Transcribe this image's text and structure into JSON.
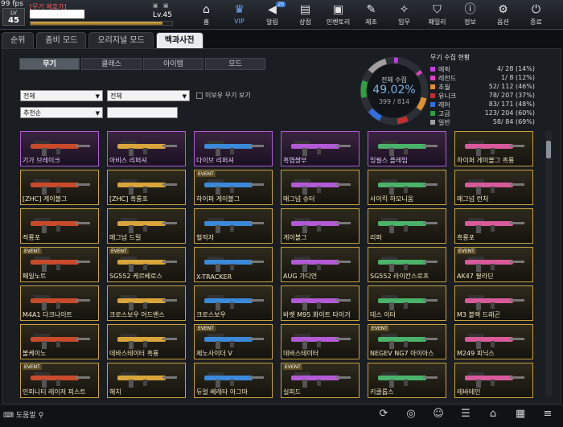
{
  "fps": "99 fps",
  "player": {
    "rank_label": "LV",
    "rank_value": "45",
    "name": "[무기 애호가]",
    "level": "Lv.45",
    "xp_fraction": 0.93
  },
  "nav": [
    {
      "label": "홈",
      "icon": "home-icon"
    },
    {
      "label": "VIP",
      "icon": "crown-icon"
    },
    {
      "label": "알림",
      "icon": "megaphone-icon",
      "badge": "20"
    },
    {
      "label": "상점",
      "icon": "shop-icon"
    },
    {
      "label": "인벤토리",
      "icon": "bag-icon"
    },
    {
      "label": "제조",
      "icon": "craft-icon"
    },
    {
      "label": "임무",
      "icon": "mission-icon"
    },
    {
      "label": "패밀리",
      "icon": "family-icon"
    },
    {
      "label": "정보",
      "icon": "info-icon"
    },
    {
      "label": "옵션",
      "icon": "gear-icon"
    },
    {
      "label": "종료",
      "icon": "power-icon"
    }
  ],
  "tabs1": [
    "순위",
    "좀비 모드",
    "오리지널 모드",
    "백과사전"
  ],
  "tabs2": [
    "무기",
    "클래스",
    "아이템",
    "모드"
  ],
  "filter": {
    "f1": "전체",
    "f2": "전체",
    "sort": "추천순",
    "checkbox": "미보유 무기 보기"
  },
  "collection": {
    "label": "전체 수집",
    "percent": "49.02%",
    "count": "399 / 814"
  },
  "stats": {
    "title": "무기 수집 현황",
    "rows": [
      {
        "name": "에픽",
        "value": "4/  28 (14%)",
        "color": "#c040e0"
      },
      {
        "name": "레전드",
        "value": "1/   8 (12%)",
        "color": "#e040c0"
      },
      {
        "name": "초월",
        "value": "52/ 112 (46%)",
        "color": "#e09030"
      },
      {
        "name": "유니크",
        "value": "78/ 207 (37%)",
        "color": "#c03030"
      },
      {
        "name": "레어",
        "value": "83/ 171 (48%)",
        "color": "#3070e0"
      },
      {
        "name": "고급",
        "value": "123/ 204 (60%)",
        "color": "#30a040"
      },
      {
        "name": "일반",
        "value": "58/  84 (69%)",
        "color": "#a0a0a0"
      }
    ],
    "fractions": [
      0.14,
      0.12,
      0.46,
      0.37,
      0.48,
      0.6,
      0.69
    ],
    "total_fraction": 0.4902
  },
  "weapons": [
    {
      "name": "기가 브레이크",
      "event": false,
      "tier": "purple"
    },
    {
      "name": "아비스 리퍼셔",
      "event": false,
      "tier": "purple"
    },
    {
      "name": "다이브 리퍼셔",
      "event": false,
      "tier": "purple"
    },
    {
      "name": "흑염쌍부",
      "event": false,
      "tier": "purple"
    },
    {
      "name": "잉필스 플레임",
      "event": false,
      "tier": "purple"
    },
    {
      "name": "하이퍼 게이볼그 흑룡",
      "event": false,
      "tier": "gold"
    },
    {
      "name": "[ZHC] 게이볼그",
      "event": false,
      "tier": "gold"
    },
    {
      "name": "[ZHC] 흑룡포",
      "event": false,
      "tier": "gold"
    },
    {
      "name": "하이퍼 게이볼그",
      "event": true,
      "tier": "gold"
    },
    {
      "name": "매그넘 슈터",
      "event": false,
      "tier": "gold"
    },
    {
      "name": "사이킥 하모니움",
      "event": false,
      "tier": "gold"
    },
    {
      "name": "매그넘 런처",
      "event": false,
      "tier": "gold"
    },
    {
      "name": "적룡포",
      "event": false,
      "tier": "gold"
    },
    {
      "name": "매그넘 드릴",
      "event": false,
      "tier": "gold"
    },
    {
      "name": "혈적자",
      "event": false,
      "tier": "gold"
    },
    {
      "name": "게이볼그",
      "event": false,
      "tier": "gold"
    },
    {
      "name": "리퍼",
      "event": false,
      "tier": "gold"
    },
    {
      "name": "흑룡포",
      "event": false,
      "tier": "gold"
    },
    {
      "name": "페일노트",
      "event": true,
      "tier": "gold"
    },
    {
      "name": "SG552 케르베로스",
      "event": true,
      "tier": "gold"
    },
    {
      "name": "X-TRACKER",
      "event": false,
      "tier": "gold"
    },
    {
      "name": "AUG 가디언",
      "event": false,
      "tier": "gold"
    },
    {
      "name": "SG552 라이칸스로프",
      "event": false,
      "tier": "gold"
    },
    {
      "name": "AK47 팔라딘",
      "event": true,
      "tier": "gold"
    },
    {
      "name": "M4A1 다크나이트",
      "event": false,
      "tier": "gold"
    },
    {
      "name": "크로스보우 어드밴스",
      "event": false,
      "tier": "gold"
    },
    {
      "name": "크로스보우",
      "event": false,
      "tier": "gold"
    },
    {
      "name": "바렛 M95 화이트 타이거",
      "event": false,
      "tier": "gold"
    },
    {
      "name": "데스 이터",
      "event": false,
      "tier": "gold"
    },
    {
      "name": "M3 블랙 드래곤",
      "event": false,
      "tier": "gold"
    },
    {
      "name": "볼케이노",
      "event": false,
      "tier": "gold"
    },
    {
      "name": "데바스테이터 흑룡",
      "event": false,
      "tier": "gold"
    },
    {
      "name": "제노사이더 V",
      "event": true,
      "tier": "gold"
    },
    {
      "name": "데바스테이터",
      "event": false,
      "tier": "gold"
    },
    {
      "name": "NEGEV NG7 아이아스",
      "event": true,
      "tier": "gold"
    },
    {
      "name": "M249 피닉스",
      "event": false,
      "tier": "gold"
    },
    {
      "name": "인피니티 레이저 피스트",
      "event": true,
      "tier": "gold"
    },
    {
      "name": "해치",
      "event": false,
      "tier": "gold"
    },
    {
      "name": "듀얼 베레타 아그마",
      "event": false,
      "tier": "gold"
    },
    {
      "name": "실피드",
      "event": true,
      "tier": "gold"
    },
    {
      "name": "키클롭스",
      "event": false,
      "tier": "gold"
    },
    {
      "name": "레바테인",
      "event": false,
      "tier": "gold"
    }
  ],
  "event_label": "EVENT",
  "bottom": {
    "help": "도움말"
  }
}
